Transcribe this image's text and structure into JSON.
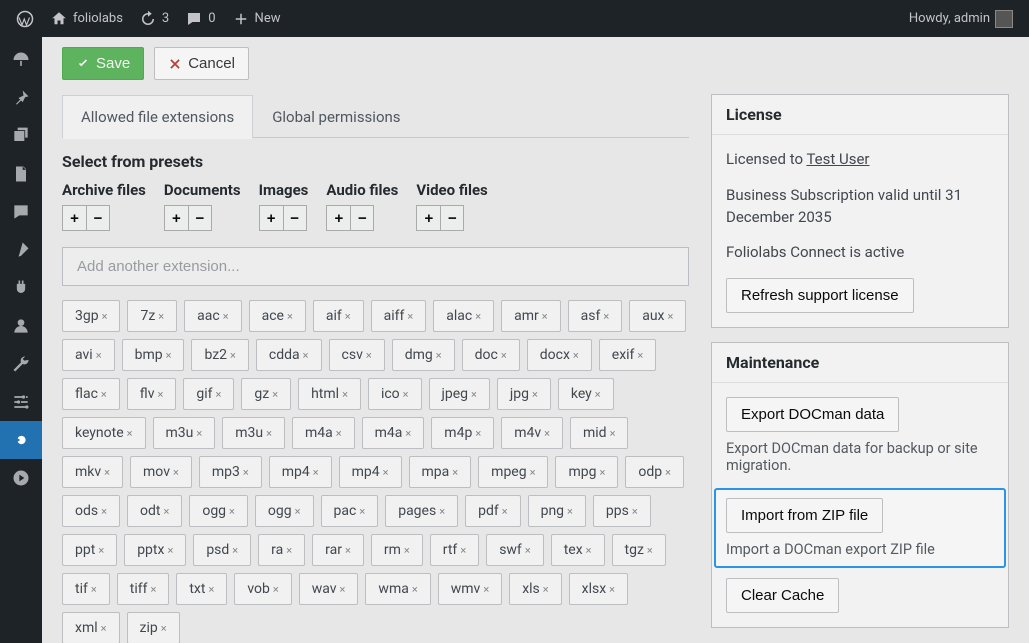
{
  "topbar": {
    "site_name": "foliolabs",
    "updates": "3",
    "comments": "0",
    "new_label": "New",
    "greeting": "Howdy, admin"
  },
  "actions": {
    "save": "Save",
    "cancel": "Cancel"
  },
  "tabs": [
    {
      "label": "Allowed file extensions",
      "active": true
    },
    {
      "label": "Global permissions",
      "active": false
    }
  ],
  "presets_heading": "Select from presets",
  "preset_groups": [
    "Archive files",
    "Documents",
    "Images",
    "Audio files",
    "Video files"
  ],
  "ext_placeholder": "Add another extension...",
  "extensions": [
    "3gp",
    "7z",
    "aac",
    "ace",
    "aif",
    "aiff",
    "alac",
    "amr",
    "asf",
    "aux",
    "avi",
    "bmp",
    "bz2",
    "cdda",
    "csv",
    "dmg",
    "doc",
    "docx",
    "exif",
    "flac",
    "flv",
    "gif",
    "gz",
    "html",
    "ico",
    "jpeg",
    "jpg",
    "key",
    "keynote",
    "m3u",
    "m3u",
    "m4a",
    "m4a",
    "m4p",
    "m4v",
    "mid",
    "mkv",
    "mov",
    "mp3",
    "mp4",
    "mp4",
    "mpa",
    "mpeg",
    "mpg",
    "odp",
    "ods",
    "odt",
    "ogg",
    "ogg",
    "pac",
    "pages",
    "pdf",
    "png",
    "pps",
    "ppt",
    "pptx",
    "psd",
    "ra",
    "rar",
    "rm",
    "rtf",
    "swf",
    "tex",
    "tgz",
    "tif",
    "tiff",
    "txt",
    "vob",
    "wav",
    "wma",
    "wmv",
    "xls",
    "xlsx",
    "xml",
    "zip"
  ],
  "license": {
    "title": "License",
    "licensed_prefix": "Licensed to ",
    "user": "Test User",
    "subscription": "Business Subscription valid until 31 December 2035",
    "connect": "Foliolabs Connect is active",
    "refresh": "Refresh support license"
  },
  "maintenance": {
    "title": "Maintenance",
    "export_btn": "Export DOCman data",
    "export_desc": "Export DOCman data for backup or site migration.",
    "import_btn": "Import from ZIP file",
    "import_desc": "Import a DOCman export ZIP file",
    "cache_btn": "Clear Cache"
  }
}
